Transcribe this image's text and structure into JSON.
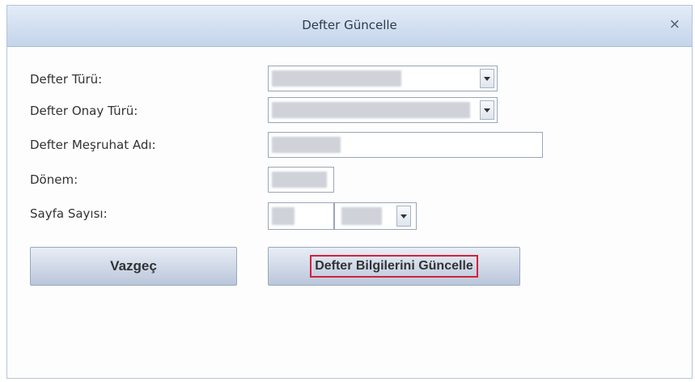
{
  "dialog": {
    "title": "Defter Güncelle",
    "close_label": "×"
  },
  "form": {
    "defter_turu_label": "Defter Türü:",
    "defter_onay_turu_label": "Defter Onay Türü:",
    "defter_mesruhat_adi_label": "Defter Meşruhat Adı:",
    "donem_label": "Dönem:",
    "sayfa_sayisi_label": "Sayfa Sayısı:"
  },
  "buttons": {
    "cancel_label": "Vazgeç",
    "update_label": "Defter Bilgilerini Güncelle"
  },
  "colors": {
    "titlebar": "#c4d4ea",
    "highlight": "#d6203b"
  },
  "icons": {
    "close": "close-icon",
    "dropdown": "chevron-down-icon"
  }
}
